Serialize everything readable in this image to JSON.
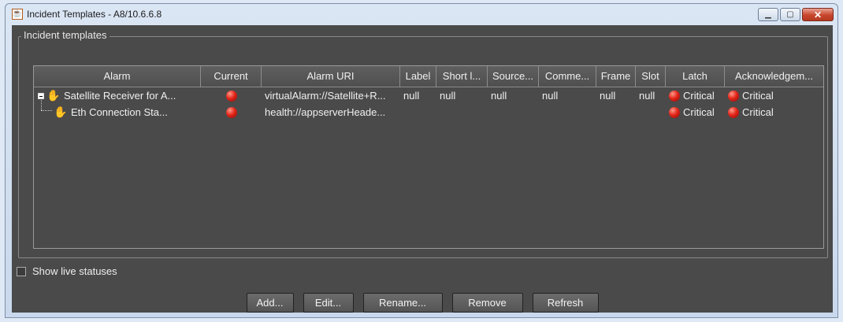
{
  "window": {
    "title": "Incident Templates - A8/10.6.6.8",
    "app_icon": "java-cup-icon",
    "buttons": [
      "minimize-icon",
      "maximize-icon",
      "close-icon"
    ]
  },
  "group": {
    "title": "Incident templates"
  },
  "table": {
    "columns": [
      "Alarm",
      "Current",
      "Alarm URI",
      "Label",
      "Short l...",
      "Source...",
      "Comme...",
      "Frame",
      "Slot",
      "Latch",
      "Acknowledgem..."
    ],
    "rows": [
      {
        "alarm": "Satellite Receiver for A...",
        "uri": "virtualAlarm://Satellite+R...",
        "label": "null",
        "short": "null",
        "source": "null",
        "comment": "null",
        "frame": "null",
        "slot": "null",
        "latch": "Critical",
        "ack": "Critical"
      },
      {
        "alarm": "Eth Connection Sta...",
        "uri": "health://appserverHeade...",
        "label": "",
        "short": "",
        "source": "",
        "comment": "",
        "frame": "",
        "slot": "",
        "latch": "Critical",
        "ack": "Critical"
      }
    ]
  },
  "show_live": {
    "label": "Show live statuses",
    "checked": false
  },
  "actions": {
    "add": "Add...",
    "edit": "Edit...",
    "rename": "Rename...",
    "remove": "Remove",
    "refresh": "Refresh"
  },
  "colors": {
    "panel_bg": "#4a4a4a",
    "critical": "#e3261a"
  }
}
